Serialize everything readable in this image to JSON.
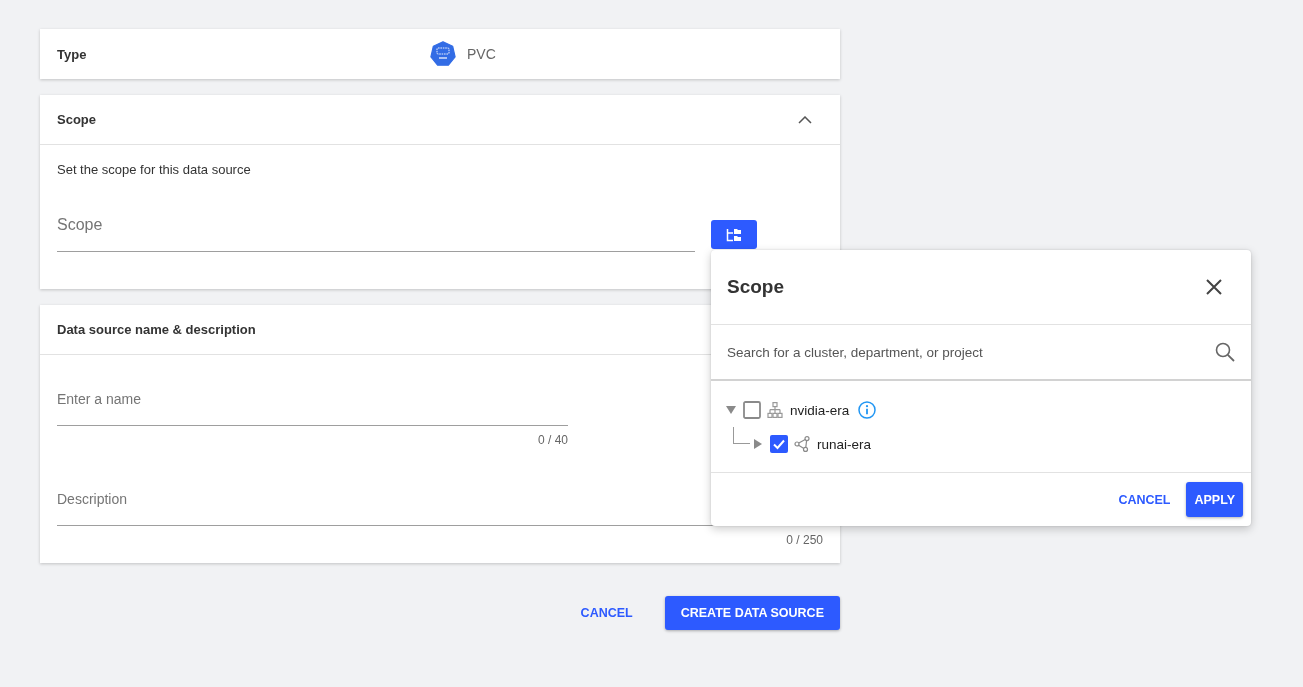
{
  "type_card": {
    "label": "Type",
    "value": "PVC"
  },
  "scope_card": {
    "title": "Scope",
    "expanded": true,
    "description": "Set the scope for this data source",
    "field": {
      "placeholder": "Scope"
    }
  },
  "name_card": {
    "title": "Data source name & description",
    "name_field": {
      "placeholder": "Enter a name",
      "counter": "0 / 40"
    },
    "description_field": {
      "placeholder": "Description",
      "counter": "0 / 250"
    }
  },
  "actions": [
    {
      "label": "CANCEL",
      "kind": "text"
    },
    {
      "label": "CREATE DATA SOURCE",
      "kind": "contained"
    }
  ],
  "scope_popover": {
    "title": "Scope",
    "search": {
      "placeholder": "Search for a cluster, department, or project"
    },
    "tree": [
      {
        "label": "nvidia-era",
        "kind": "cluster",
        "expanded": true,
        "checked": false,
        "info": true,
        "children": [
          {
            "label": "runai-era",
            "kind": "project",
            "expanded": false,
            "checked": true,
            "info": false
          }
        ]
      }
    ],
    "actions": [
      {
        "label": "CANCEL",
        "kind": "text"
      },
      {
        "label": "APPLY",
        "kind": "contained"
      }
    ]
  }
}
